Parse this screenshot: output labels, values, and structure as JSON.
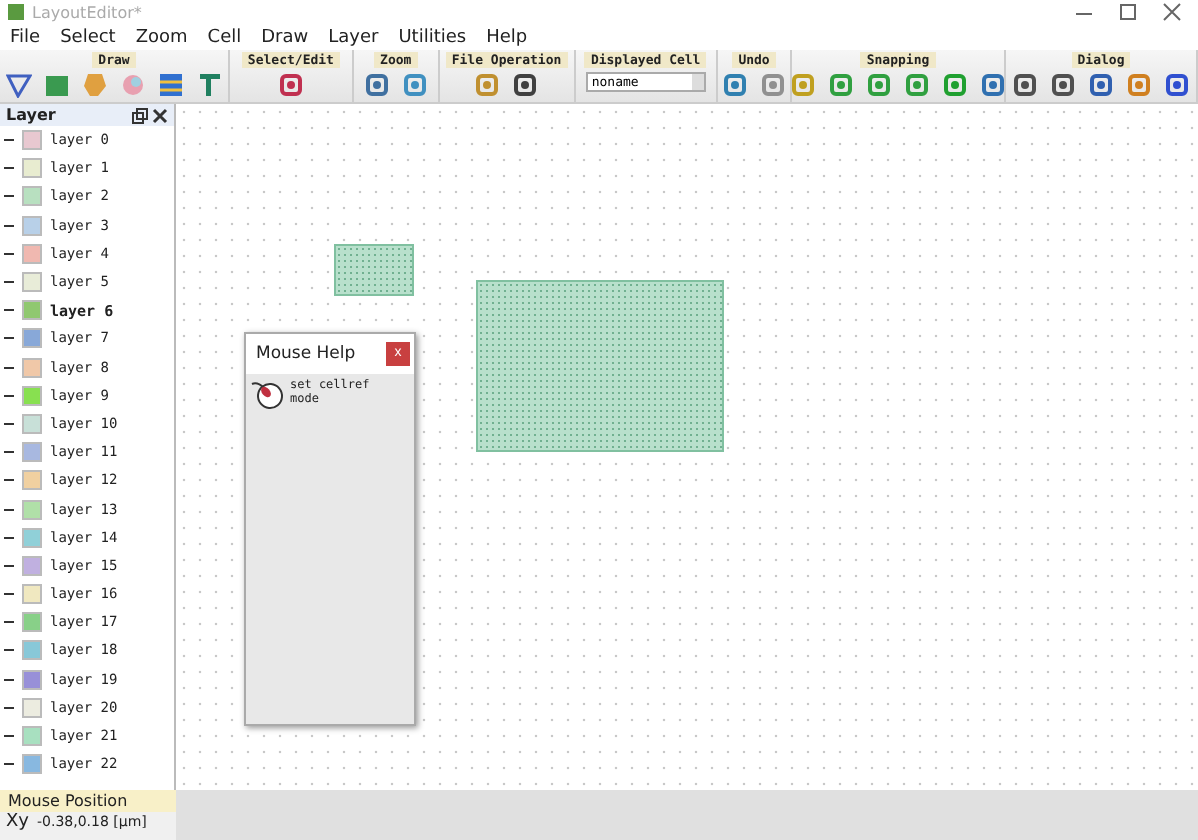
{
  "window": {
    "title": "LayoutEditor*"
  },
  "menu": [
    "File",
    "Select",
    "Zoom",
    "Cell",
    "Draw",
    "Layer",
    "Utilities",
    "Help"
  ],
  "toolbar": [
    {
      "label": "Draw"
    },
    {
      "label": "Select/Edit"
    },
    {
      "label": "Zoom"
    },
    {
      "label": "File Operation"
    },
    {
      "label": "Displayed Cell",
      "value": "noname"
    },
    {
      "label": "Undo"
    },
    {
      "label": "Snapping"
    },
    {
      "label": "Dialog"
    }
  ],
  "layer_panel": {
    "title": "Layer",
    "layers": [
      {
        "name": "layer 0",
        "color": "#e8c8d0",
        "selected": false
      },
      {
        "name": "layer 1",
        "color": "#e8ecd0",
        "selected": false
      },
      {
        "name": "layer 2",
        "color": "#b8e0c0",
        "selected": false
      },
      {
        "name": "layer 3",
        "color": "#b8d0e8",
        "selected": false
      },
      {
        "name": "layer 4",
        "color": "#f0b8b0",
        "selected": false
      },
      {
        "name": "layer 5",
        "color": "#e8ecd8",
        "selected": false
      },
      {
        "name": "layer 6",
        "color": "#90c870",
        "selected": true
      },
      {
        "name": "layer 7",
        "color": "#88a8d8",
        "selected": false
      },
      {
        "name": "layer 8",
        "color": "#f0c8a8",
        "selected": false
      },
      {
        "name": "layer 9",
        "color": "#88e050",
        "selected": false
      },
      {
        "name": "layer 10",
        "color": "#c8e0d8",
        "selected": false
      },
      {
        "name": "layer 11",
        "color": "#a8b8e0",
        "selected": false
      },
      {
        "name": "layer 12",
        "color": "#f0d0a0",
        "selected": false
      },
      {
        "name": "layer 13",
        "color": "#b0e0a8",
        "selected": false
      },
      {
        "name": "layer 14",
        "color": "#90d0d8",
        "selected": false
      },
      {
        "name": "layer 15",
        "color": "#c0b0e0",
        "selected": false
      },
      {
        "name": "layer 16",
        "color": "#f0e8c0",
        "selected": false
      },
      {
        "name": "layer 17",
        "color": "#88d088",
        "selected": false
      },
      {
        "name": "layer 18",
        "color": "#88c8d8",
        "selected": false
      },
      {
        "name": "layer 19",
        "color": "#9890d8",
        "selected": false
      },
      {
        "name": "layer 20",
        "color": "#ecece0",
        "selected": false
      },
      {
        "name": "layer 21",
        "color": "#a8e0c0",
        "selected": false
      },
      {
        "name": "layer 22",
        "color": "#88b8e0",
        "selected": false
      }
    ]
  },
  "mouse_help": {
    "title": "Mouse Help",
    "close": "x",
    "text": "set cellref mode"
  },
  "status": {
    "title": "Mouse Position",
    "axis": "Xy",
    "value": "-0.38,0.18 [µm]"
  }
}
